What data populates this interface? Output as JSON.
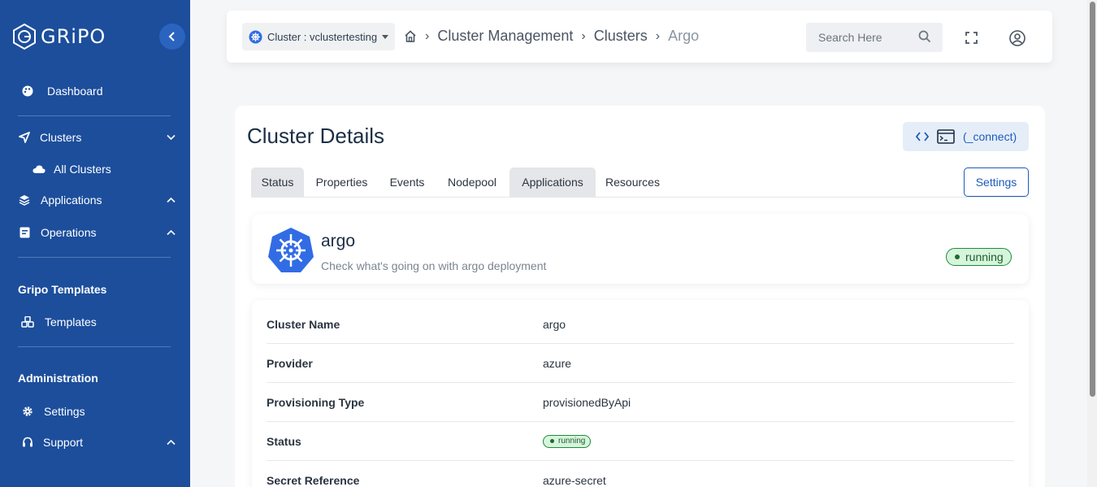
{
  "brand": {
    "name": "GRiPO"
  },
  "sidebar": {
    "items": [
      {
        "label": "Dashboard",
        "icon": "palette-icon"
      },
      {
        "label": "Clusters",
        "icon": "send-icon"
      },
      {
        "label": "All Clusters",
        "icon": "cloud-icon"
      },
      {
        "label": "Applications",
        "icon": "layers-icon"
      },
      {
        "label": "Operations",
        "icon": "document-icon"
      },
      {
        "label": "Templates",
        "icon": "cubes-icon"
      },
      {
        "label": "Settings",
        "icon": "gear-icon"
      },
      {
        "label": "Support",
        "icon": "headset-icon"
      }
    ],
    "sections": [
      "Gripo Templates",
      "Administration"
    ]
  },
  "topbar": {
    "cluster_select": "Cluster : vclustertesting",
    "breadcrumb": [
      "Cluster Management",
      "Clusters",
      "Argo"
    ],
    "search_placeholder": "Search Here"
  },
  "page": {
    "title": "Cluster Details",
    "connect_label": "(_connect)",
    "tabs": [
      "Status",
      "Properties",
      "Events",
      "Nodepool",
      "Applications",
      "Resources"
    ],
    "settings_label": "Settings"
  },
  "app": {
    "name": "argo",
    "description": "Check what's going on with argo deployment",
    "status": "running"
  },
  "details": [
    {
      "key": "Cluster Name",
      "value": "argo"
    },
    {
      "key": "Provider",
      "value": "azure"
    },
    {
      "key": "Provisioning Type",
      "value": "provisionedByApi"
    },
    {
      "key": "Status",
      "value": "running"
    },
    {
      "key": "Secret Reference",
      "value": "azure-secret"
    }
  ],
  "colors": {
    "sidebar": "#1c4e9c",
    "accent": "#1c5cb8",
    "running_bg": "#d6f5dc"
  }
}
